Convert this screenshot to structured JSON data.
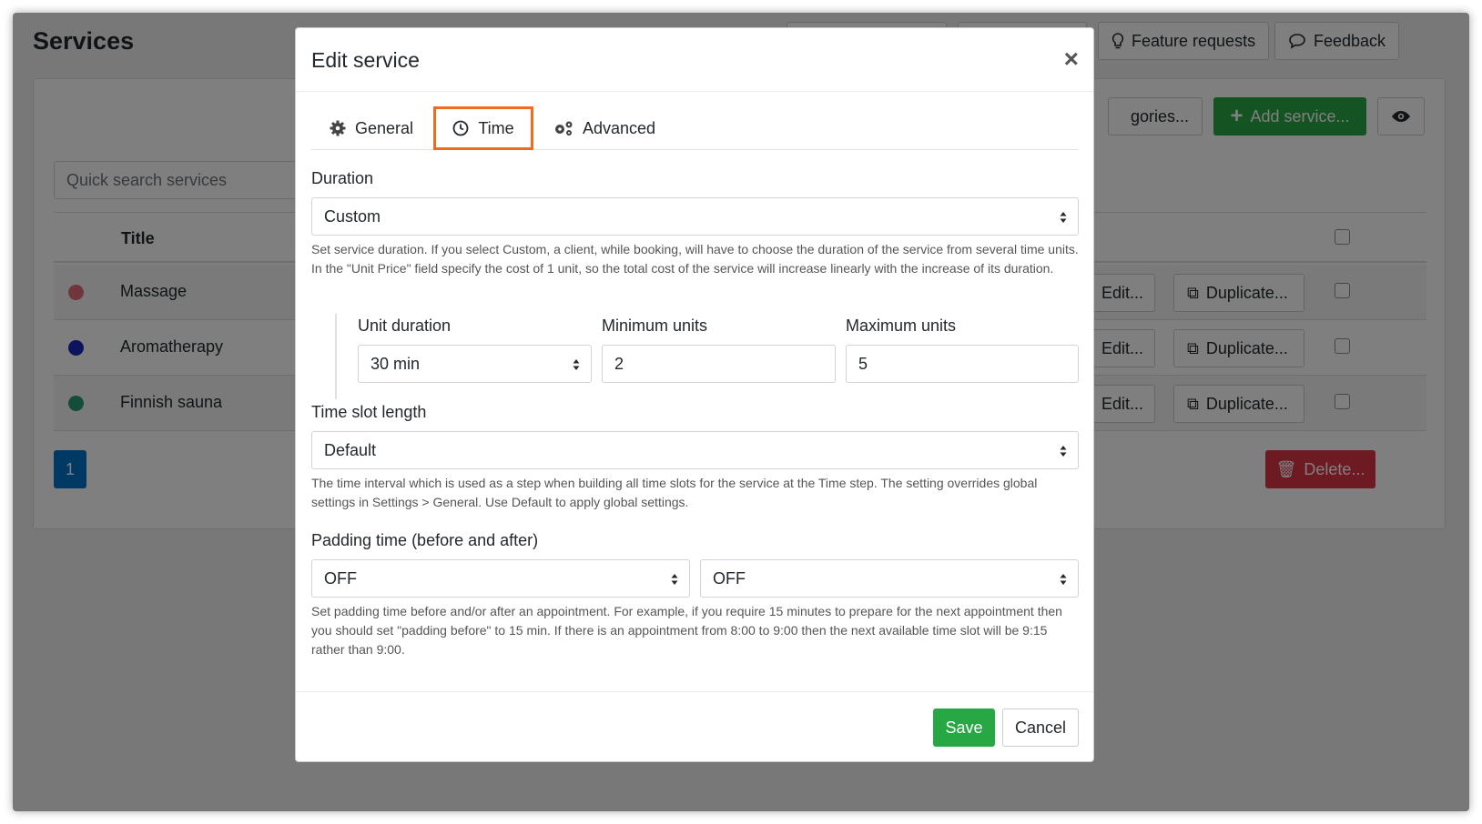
{
  "page": {
    "title": "Services",
    "header_buttons": [
      {
        "label": "Feature requests",
        "icon": "lightbulb-icon"
      },
      {
        "label": "Feedback",
        "icon": "chat-icon"
      }
    ],
    "search_placeholder": "Quick search services",
    "categories_label": "gories...",
    "add_service_label": "Add service...",
    "table": {
      "columns": [
        "Title"
      ],
      "rows": [
        {
          "title": "Massage",
          "color": "#e26a7c",
          "edit": "Edit...",
          "duplicate": "Duplicate..."
        },
        {
          "title": "Aromatherapy",
          "color": "#1d28b8",
          "edit": "Edit...",
          "duplicate": "Duplicate..."
        },
        {
          "title": "Finnish sauna",
          "color": "#2b9b7a",
          "edit": "Edit...",
          "duplicate": "Duplicate..."
        }
      ]
    },
    "pagination": {
      "current": "1"
    },
    "delete_label": "Delete..."
  },
  "modal": {
    "title": "Edit service",
    "close_symbol": "×",
    "tabs": [
      {
        "label": "General",
        "icon": "gear-icon"
      },
      {
        "label": "Time",
        "icon": "clock-icon",
        "active": true
      },
      {
        "label": "Advanced",
        "icon": "gears-icon"
      }
    ],
    "duration": {
      "label": "Duration",
      "value": "Custom",
      "help": "Set service duration. If you select Custom, a client, while booking, will have to choose the duration of the service from several time units. In the \"Unit Price\" field specify the cost of 1 unit, so the total cost of the service will increase linearly with the increase of its duration."
    },
    "unit_duration": {
      "label": "Unit duration",
      "value": "30 min"
    },
    "minimum_units": {
      "label": "Minimum units",
      "value": "2"
    },
    "maximum_units": {
      "label": "Maximum units",
      "value": "5"
    },
    "time_slot": {
      "label": "Time slot length",
      "value": "Default",
      "help": "The time interval which is used as a step when building all time slots for the service at the Time step. The setting overrides global settings in Settings > General. Use Default to apply global settings."
    },
    "padding": {
      "label": "Padding time (before and after)",
      "before": "OFF",
      "after": "OFF",
      "help": "Set padding time before and/or after an appointment. For example, if you require 15 minutes to prepare for the next appointment then you should set \"padding before\" to 15 min. If there is an appointment from 8:00 to 9:00 then the next available time slot will be 9:15 rather than 9:00."
    },
    "footer": {
      "save": "Save",
      "cancel": "Cancel"
    }
  },
  "colors": {
    "accent_tab": "#f06a22",
    "success": "#28a745",
    "danger": "#dc3545",
    "primary": "#0073c9"
  }
}
